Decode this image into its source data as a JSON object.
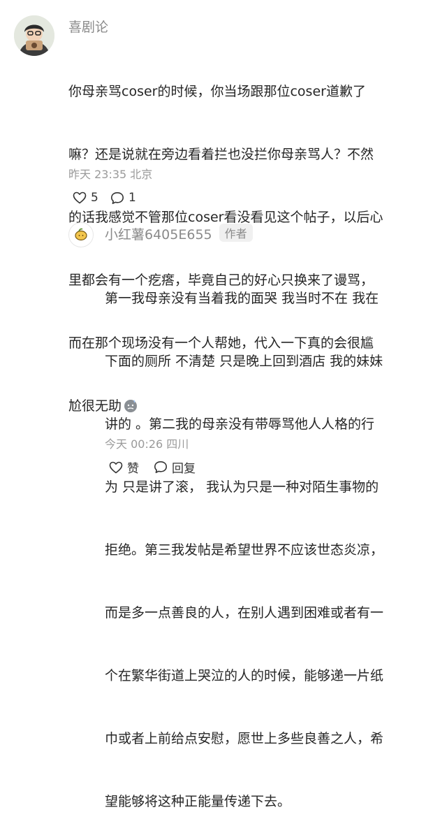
{
  "comment": {
    "username": "喜剧论",
    "text_lines": [
      "你母亲骂coser的时候，你当场跟那位coser道歉了",
      "嘛？还是说就在旁边看着拦也没拦你母亲骂人？不然",
      "的话我感觉不管那位coser看没看见这个帖子，以后心",
      "里都会有一个疙瘩，毕竟自己的好心只换来了谩骂，",
      "而在那个现场没有一个人帮她，代入一下真的会很尴",
      "尬很无助"
    ],
    "emoji_icon": "sweat-face-icon",
    "timestamp": "昨天 23:35 北京",
    "likes": "5",
    "replies": "1"
  },
  "reply": {
    "username": "小红薯6405E655",
    "badge": "作者",
    "text_lines": [
      "第一我母亲没有当着我的面哭 我当时不在 我在",
      "下面的厕所 不清楚 只是晚上回到酒店 我的妹妹",
      "讲的 。第二我的母亲没有带辱骂他人人格的行",
      "为 只是讲了滚， 我认为只是一种对陌生事物的",
      "拒绝。第三我发帖是希望世界不应该世态炎凉，",
      "而是多一点善良的人，在别人遇到困难或者有一",
      "个在繁华街道上哭泣的人的时候，能够递一片纸",
      "巾或者上前给点安慰，愿世上多些良善之人，希",
      "望能够将这种正能量传递下去。"
    ],
    "timestamp": "今天 00:26 四川",
    "like_label": "赞",
    "reply_label": "回复"
  }
}
